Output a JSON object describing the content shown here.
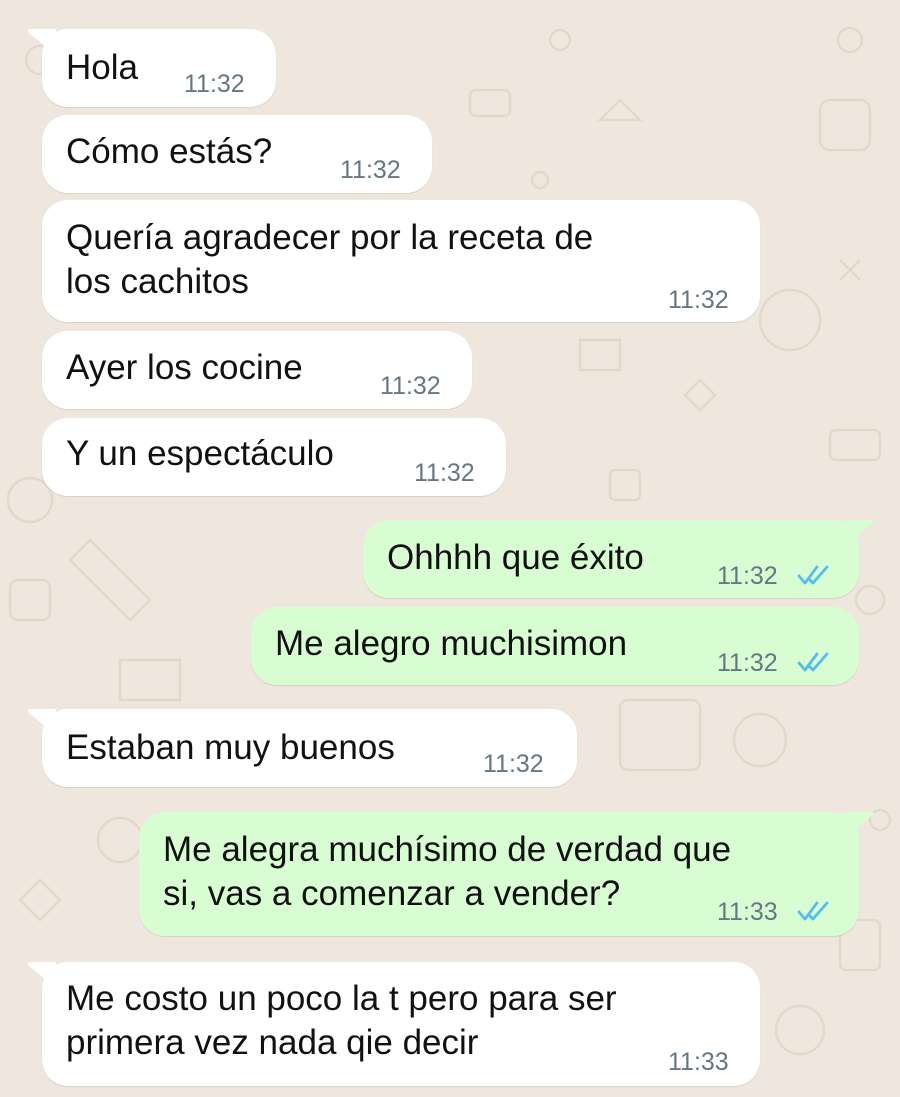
{
  "colors": {
    "incoming_bubble": "#ffffff",
    "outgoing_bubble": "#d9fdd3",
    "read_ticks": "#53bdeb",
    "timestamp": "#667781",
    "wallpaper": "#efe7dd"
  },
  "messages": [
    {
      "direction": "incoming",
      "text": "Hola",
      "time": "11:32"
    },
    {
      "direction": "incoming",
      "text": "Cómo estás?",
      "time": "11:32"
    },
    {
      "direction": "incoming",
      "text": "Quería agradecer por la receta de\nlos cachitos",
      "time": "11:32"
    },
    {
      "direction": "incoming",
      "text": "Ayer los cocine",
      "time": "11:32"
    },
    {
      "direction": "incoming",
      "text": "Y un espectáculo",
      "time": "11:32"
    },
    {
      "direction": "outgoing",
      "text": "Ohhhh que éxito",
      "time": "11:32",
      "status": "read-ticks-icon"
    },
    {
      "direction": "outgoing",
      "text": "Me alegro muchisimon",
      "time": "11:32",
      "status": "read-ticks-icon"
    },
    {
      "direction": "incoming",
      "text": "Estaban muy buenos",
      "time": "11:32"
    },
    {
      "direction": "outgoing",
      "text": "Me alegra muchísimo de verdad que\nsi, vas a comenzar a vender?",
      "time": "11:33",
      "status": "read-ticks-icon"
    },
    {
      "direction": "incoming",
      "text": "Me costo un poco la t pero para ser\nprimera vez nada qie decir",
      "time": "11:33"
    }
  ]
}
